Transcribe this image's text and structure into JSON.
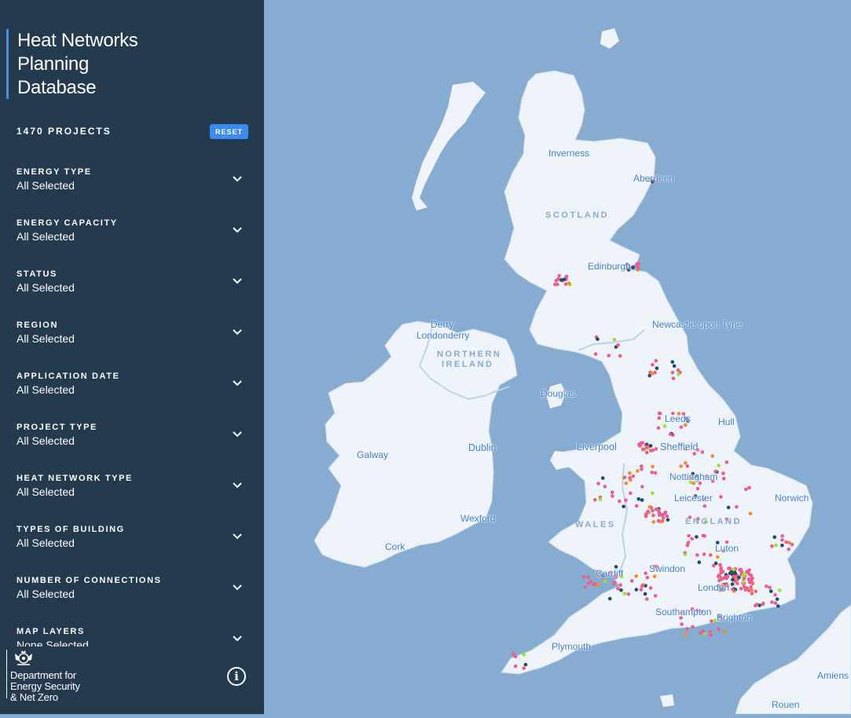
{
  "sidebar": {
    "title": [
      "Heat Networks",
      "Planning",
      "Database"
    ],
    "projects_count": "1470 PROJECTS",
    "reset_label": "RESET",
    "filters": [
      {
        "label": "ENERGY TYPE",
        "value": "All Selected"
      },
      {
        "label": "ENERGY CAPACITY",
        "value": "All Selected"
      },
      {
        "label": "STATUS",
        "value": "All Selected"
      },
      {
        "label": "REGION",
        "value": "All Selected"
      },
      {
        "label": "APPLICATION DATE",
        "value": "All Selected"
      },
      {
        "label": "PROJECT TYPE",
        "value": "All Selected"
      },
      {
        "label": "HEAT NETWORK TYPE",
        "value": "All Selected"
      },
      {
        "label": "TYPES OF BUILDING",
        "value": "All Selected"
      },
      {
        "label": "NUMBER OF CONNECTIONS",
        "value": "All Selected"
      },
      {
        "label": "MAP LAYERS",
        "value": "None Selected"
      }
    ],
    "footer": {
      "dept_lines": [
        "Department for",
        "Energy Security",
        "& Net Zero"
      ],
      "info_label": "i"
    }
  },
  "map": {
    "colors": {
      "sea": "#86acd1",
      "land": "#eef3fa",
      "border": "#bcd2ea",
      "label": "#3d7fd4",
      "country_label": "#8aa9c8"
    },
    "dot_colors": [
      "#ea5e8d",
      "#1e4d6e",
      "#f28c28",
      "#9be22b"
    ],
    "places": [
      {
        "name": "Inverness"
      },
      {
        "name": "Aberdeen"
      },
      {
        "name": "Edinburgh"
      },
      {
        "name": "Londonderry"
      },
      {
        "name": "Derry"
      },
      {
        "name": "Newcastle upon Tyne"
      },
      {
        "name": "Douglas"
      },
      {
        "name": "Leeds"
      },
      {
        "name": "Hull"
      },
      {
        "name": "Liverpool"
      },
      {
        "name": "Sheffield"
      },
      {
        "name": "Nottingham"
      },
      {
        "name": "Dublin"
      },
      {
        "name": "Galway"
      },
      {
        "name": "Leicester"
      },
      {
        "name": "Norwich"
      },
      {
        "name": "Wexford"
      },
      {
        "name": "Cork"
      },
      {
        "name": "Luton"
      },
      {
        "name": "Cardiff"
      },
      {
        "name": "Swindon"
      },
      {
        "name": "London"
      },
      {
        "name": "Southampton"
      },
      {
        "name": "Brighton"
      },
      {
        "name": "Plymouth"
      },
      {
        "name": "Amiens"
      },
      {
        "name": "Rouen"
      }
    ],
    "countries": [
      "SCOTLAND",
      "NORTHERN",
      "IRELAND",
      "WALES",
      "ENGLAND"
    ]
  }
}
